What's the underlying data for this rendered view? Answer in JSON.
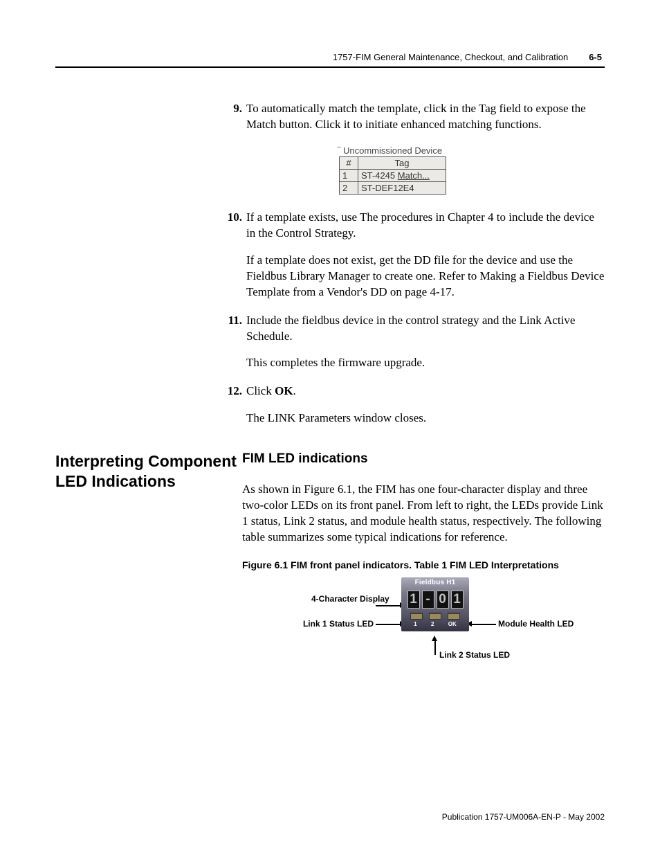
{
  "header": {
    "title": "1757-FIM General Maintenance, Checkout, and Calibration",
    "page": "6-5"
  },
  "steps": {
    "s9": {
      "num": "9.",
      "p1": "To automatically match the template, click in the Tag field to expose the Match button. Click it to initiate enhanced matching functions."
    },
    "table": {
      "title": "Uncommissioned Device",
      "h1": "#",
      "h2": "Tag",
      "r1n": "1",
      "r1t_a": "ST-4245 ",
      "r1t_b": "Match...",
      "r2n": "2",
      "r2t": "ST-DEF12E4"
    },
    "s10": {
      "num": "10.",
      "p1": "If a template exists, use The procedures in Chapter 4 to include the device in the Control Strategy.",
      "p2": "If a template does not exist, get the DD file for the device and use the Fieldbus Library Manager to create one. Refer to Making a Fieldbus Device Template from a Vendor's DD on page 4-17."
    },
    "s11": {
      "num": "11.",
      "p1": "Include the fieldbus device in the control strategy and the Link Active Schedule.",
      "p2": "This completes the firmware upgrade."
    },
    "s12": {
      "num": "12.",
      "p1a": "Click ",
      "p1b": "OK",
      "p1c": ".",
      "p2": "The LINK Parameters window closes."
    }
  },
  "section": {
    "left": "Interpreting Component LED Indications",
    "h3": "FIM LED indications",
    "para": "As shown in Figure 6.1, the FIM has one four-character display and three two-color LEDs on its front panel. From left to right, the LEDs provide Link 1 status, Link 2 status, and module health status, respectively. The following table summarizes some typical indications for reference.",
    "caption": "Figure 6.1  FIM front panel indicators. Table 1 FIM LED Interpretations"
  },
  "figure": {
    "device_title": "Fieldbus H1",
    "seg": [
      "1",
      "-",
      "0",
      "1"
    ],
    "led_labels": [
      "1",
      "2",
      "OK"
    ],
    "lbl_display": "4-Character Display",
    "lbl_link1": "Link 1 Status LED",
    "lbl_link2": "Link 2 Status LED",
    "lbl_health": "Module Health LED"
  },
  "footer": "Publication 1757-UM006A-EN-P - May 2002"
}
